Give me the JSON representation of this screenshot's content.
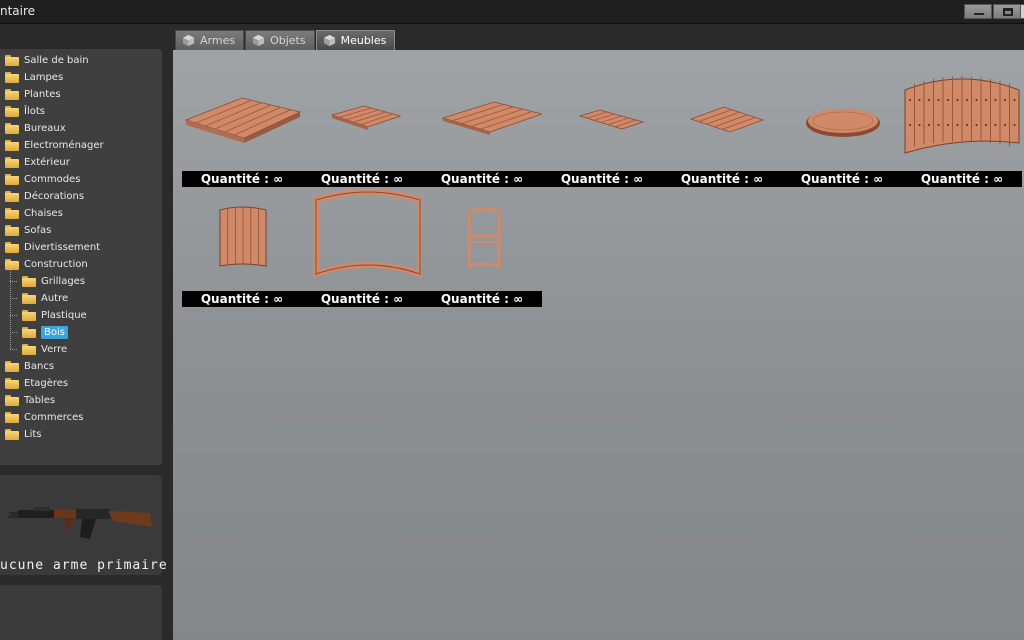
{
  "window": {
    "title": "ntaire",
    "minimize_icon": "minimize-icon",
    "maximize_icon": "maximize-icon"
  },
  "tabs": [
    {
      "label": "Armes",
      "icon": "cube-icon"
    },
    {
      "label": "Objets",
      "icon": "cube-icon"
    },
    {
      "label": "Meubles",
      "icon": "cube-icon",
      "active": true
    }
  ],
  "tree": {
    "items": [
      {
        "label": "Salle de bain"
      },
      {
        "label": "Lampes"
      },
      {
        "label": "Plantes"
      },
      {
        "label": "Îlots"
      },
      {
        "label": "Bureaux"
      },
      {
        "label": "Electroménager"
      },
      {
        "label": "Extérieur"
      },
      {
        "label": "Commodes"
      },
      {
        "label": "Décorations"
      },
      {
        "label": "Chaises"
      },
      {
        "label": "Sofas"
      },
      {
        "label": "Divertissement"
      },
      {
        "label": "Construction"
      },
      {
        "label": "Grillages",
        "child": true
      },
      {
        "label": "Autre",
        "child": true
      },
      {
        "label": "Plastique",
        "child": true
      },
      {
        "label": "Bois",
        "child": true,
        "selected": true
      },
      {
        "label": "Verre",
        "child": true
      },
      {
        "label": "Bancs"
      },
      {
        "label": "Etagères"
      },
      {
        "label": "Tables"
      },
      {
        "label": "Commerces"
      },
      {
        "label": "Lits"
      }
    ]
  },
  "weapon": {
    "label": "ucune arme primaire",
    "icon": "rifle-icon"
  },
  "items": [
    {
      "icon": "wood-floor-large-icon",
      "quantity": "Quantité : ∞"
    },
    {
      "icon": "wood-floor-small-icon",
      "quantity": "Quantité : ∞"
    },
    {
      "icon": "wood-floor-medium-icon",
      "quantity": "Quantité : ∞"
    },
    {
      "icon": "wood-strip-icon",
      "quantity": "Quantité : ∞"
    },
    {
      "icon": "wood-plank-icon",
      "quantity": "Quantité : ∞"
    },
    {
      "icon": "wood-round-table-icon",
      "quantity": "Quantité : ∞"
    },
    {
      "icon": "wood-curved-wall-icon",
      "quantity": "Quantité : ∞"
    },
    {
      "icon": "wood-wall-panel-icon",
      "quantity": "Quantité : ∞"
    },
    {
      "icon": "wood-curved-window-frame-icon",
      "quantity": "Quantité : ∞"
    },
    {
      "icon": "wood-window-frame-icon",
      "quantity": "Quantité : ∞"
    }
  ],
  "colors": {
    "selection": "#3aa3e0",
    "wood": "#d08a6a",
    "folder": "#e3b23c"
  }
}
